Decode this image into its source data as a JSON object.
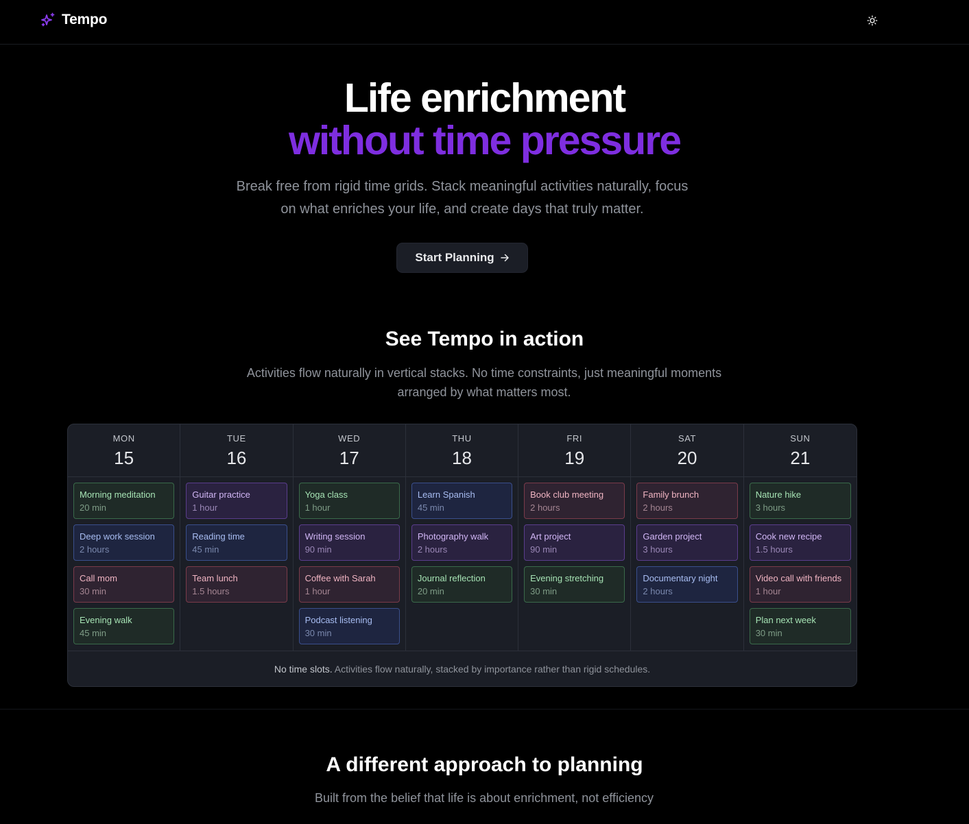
{
  "app": {
    "name": "Tempo"
  },
  "colors": {
    "accent": "#7e2ee0",
    "background": "#000000",
    "panel": "#1b1e26"
  },
  "header": {
    "logo_icon": "sparkles-icon",
    "theme_icon": "sun-icon"
  },
  "hero": {
    "title_line1": "Life enrichment",
    "title_line2": "without time pressure",
    "subtitle": "Break free from rigid time grids. Stack meaningful activities naturally, focus on what enriches your life, and create days that truly matter.",
    "cta_label": "Start Planning",
    "cta_icon": "arrow-right-icon"
  },
  "demo": {
    "title": "See Tempo in action",
    "subtitle": "Activities flow naturally in vertical stacks. No time constraints, just meaningful moments arranged by what matters most.",
    "footer_strong": "No time slots.",
    "footer_text": " Activities flow naturally, stacked by importance rather than rigid schedules.",
    "days": [
      {
        "name": "MON",
        "date": "15",
        "activities": [
          {
            "title": "Morning meditation",
            "duration": "20 min",
            "color": "green"
          },
          {
            "title": "Deep work session",
            "duration": "2 hours",
            "color": "blue"
          },
          {
            "title": "Call mom",
            "duration": "30 min",
            "color": "red"
          },
          {
            "title": "Evening walk",
            "duration": "45 min",
            "color": "green"
          }
        ]
      },
      {
        "name": "TUE",
        "date": "16",
        "activities": [
          {
            "title": "Guitar practice",
            "duration": "1 hour",
            "color": "purple"
          },
          {
            "title": "Reading time",
            "duration": "45 min",
            "color": "blue"
          },
          {
            "title": "Team lunch",
            "duration": "1.5 hours",
            "color": "red"
          }
        ]
      },
      {
        "name": "WED",
        "date": "17",
        "activities": [
          {
            "title": "Yoga class",
            "duration": "1 hour",
            "color": "green"
          },
          {
            "title": "Writing session",
            "duration": "90 min",
            "color": "purple"
          },
          {
            "title": "Coffee with Sarah",
            "duration": "1 hour",
            "color": "red"
          },
          {
            "title": "Podcast listening",
            "duration": "30 min",
            "color": "blue"
          }
        ]
      },
      {
        "name": "THU",
        "date": "18",
        "activities": [
          {
            "title": "Learn Spanish",
            "duration": "45 min",
            "color": "blue"
          },
          {
            "title": "Photography walk",
            "duration": "2 hours",
            "color": "purple"
          },
          {
            "title": "Journal reflection",
            "duration": "20 min",
            "color": "green"
          }
        ]
      },
      {
        "name": "FRI",
        "date": "19",
        "activities": [
          {
            "title": "Book club meeting",
            "duration": "2 hours",
            "color": "red"
          },
          {
            "title": "Art project",
            "duration": "90 min",
            "color": "purple"
          },
          {
            "title": "Evening stretching",
            "duration": "30 min",
            "color": "green"
          }
        ]
      },
      {
        "name": "SAT",
        "date": "20",
        "activities": [
          {
            "title": "Family brunch",
            "duration": "2 hours",
            "color": "red"
          },
          {
            "title": "Garden project",
            "duration": "3 hours",
            "color": "purple"
          },
          {
            "title": "Documentary night",
            "duration": "2 hours",
            "color": "blue"
          }
        ]
      },
      {
        "name": "SUN",
        "date": "21",
        "activities": [
          {
            "title": "Nature hike",
            "duration": "3 hours",
            "color": "green"
          },
          {
            "title": "Cook new recipe",
            "duration": "1.5 hours",
            "color": "purple"
          },
          {
            "title": "Video call with friends",
            "duration": "1 hour",
            "color": "red"
          },
          {
            "title": "Plan next week",
            "duration": "30 min",
            "color": "green"
          }
        ]
      }
    ]
  },
  "approach": {
    "title": "A different approach to planning",
    "subtitle": "Built from the belief that life is about enrichment, not efficiency"
  }
}
